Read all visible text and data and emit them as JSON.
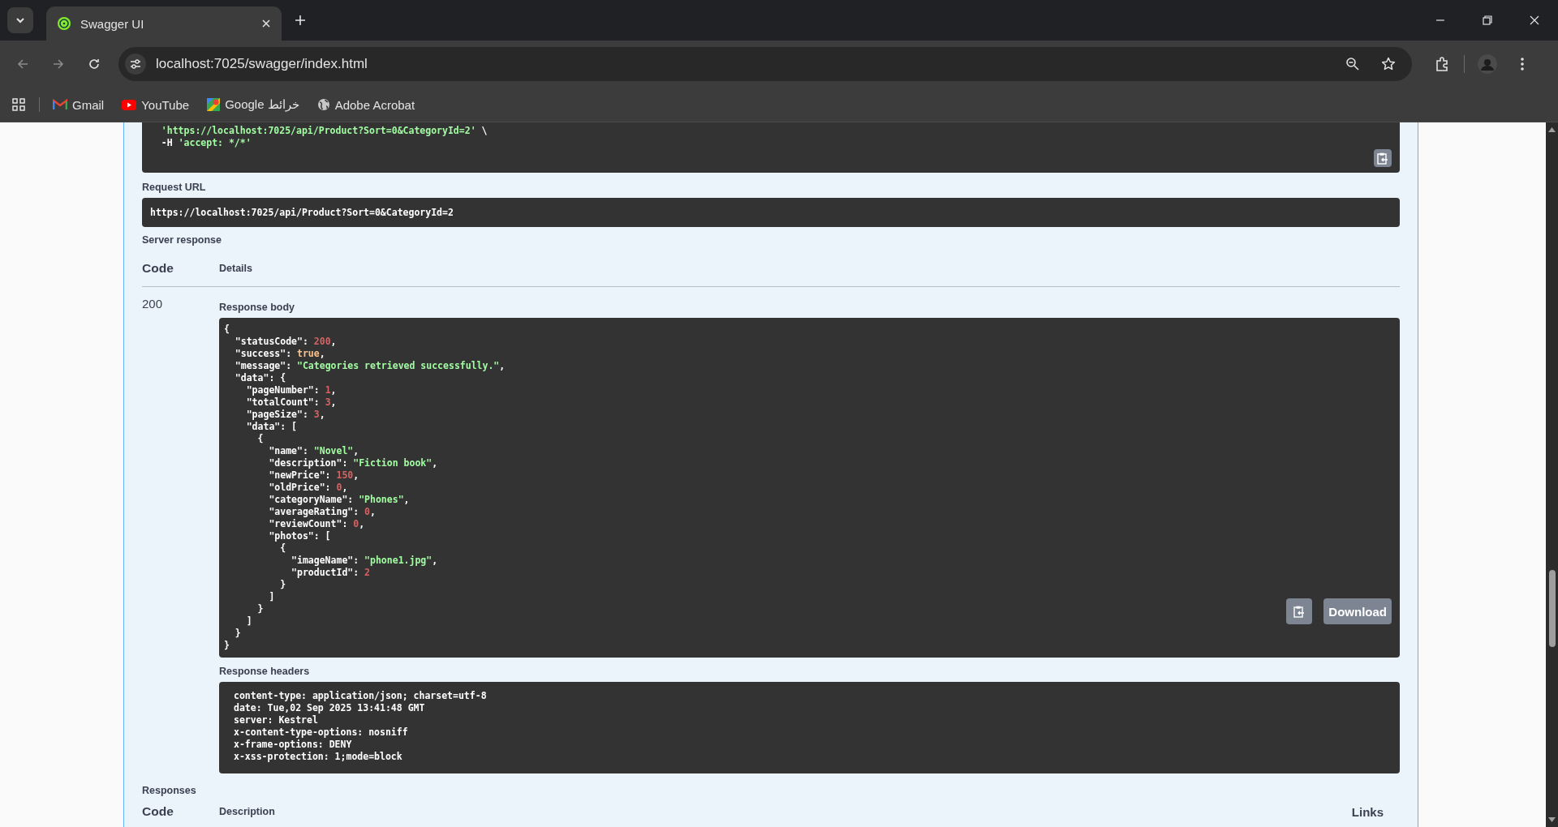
{
  "browser": {
    "tabs": [
      {
        "title": "Swagger UI",
        "selected": true
      }
    ],
    "address": "localhost:7025/swagger/index.html",
    "bookmarks": [
      {
        "label": "Gmail",
        "kind": "gmail"
      },
      {
        "label": "YouTube",
        "kind": "youtube"
      },
      {
        "label": "Google خرائط",
        "kind": "maps"
      },
      {
        "label": "Adobe Acrobat",
        "kind": "globe"
      }
    ]
  },
  "curl": {
    "lines": [
      [
        {
          "text": "  'https://localhost:7025/api/Product?Sort=0&CategoryId=2'",
          "kind": "string"
        },
        {
          "text": " \\",
          "kind": "plain"
        }
      ],
      [
        {
          "text": "  -H ",
          "kind": "plain"
        },
        {
          "text": "'accept: */*'",
          "kind": "string"
        }
      ]
    ]
  },
  "request_url": {
    "label": "Request URL",
    "value": "https://localhost:7025/api/Product?Sort=0&CategoryId=2"
  },
  "server_response": {
    "label": "Server response",
    "columns": [
      "Code",
      "Details"
    ],
    "code": "200",
    "body_label": "Response body",
    "body_lines": [
      [
        {
          "text": "{",
          "kind": "plain"
        }
      ],
      [
        {
          "text": "  \"statusCode\": ",
          "kind": "plain"
        },
        {
          "text": "200",
          "kind": "number"
        },
        {
          "text": ",",
          "kind": "plain"
        }
      ],
      [
        {
          "text": "  \"success\": ",
          "kind": "plain"
        },
        {
          "text": "true",
          "kind": "bool"
        },
        {
          "text": ",",
          "kind": "plain"
        }
      ],
      [
        {
          "text": "  \"message\": ",
          "kind": "plain"
        },
        {
          "text": "\"Categories retrieved successfully.\"",
          "kind": "string"
        },
        {
          "text": ",",
          "kind": "plain"
        }
      ],
      [
        {
          "text": "  \"data\": {",
          "kind": "plain"
        }
      ],
      [
        {
          "text": "    \"pageNumber\": ",
          "kind": "plain"
        },
        {
          "text": "1",
          "kind": "number"
        },
        {
          "text": ",",
          "kind": "plain"
        }
      ],
      [
        {
          "text": "    \"totalCount\": ",
          "kind": "plain"
        },
        {
          "text": "3",
          "kind": "number"
        },
        {
          "text": ",",
          "kind": "plain"
        }
      ],
      [
        {
          "text": "    \"pageSize\": ",
          "kind": "plain"
        },
        {
          "text": "3",
          "kind": "number"
        },
        {
          "text": ",",
          "kind": "plain"
        }
      ],
      [
        {
          "text": "    \"data\": [",
          "kind": "plain"
        }
      ],
      [
        {
          "text": "      {",
          "kind": "plain"
        }
      ],
      [
        {
          "text": "        \"name\": ",
          "kind": "plain"
        },
        {
          "text": "\"Novel\"",
          "kind": "string"
        },
        {
          "text": ",",
          "kind": "plain"
        }
      ],
      [
        {
          "text": "        \"description\": ",
          "kind": "plain"
        },
        {
          "text": "\"Fiction book\"",
          "kind": "string"
        },
        {
          "text": ",",
          "kind": "plain"
        }
      ],
      [
        {
          "text": "        \"newPrice\": ",
          "kind": "plain"
        },
        {
          "text": "150",
          "kind": "number"
        },
        {
          "text": ",",
          "kind": "plain"
        }
      ],
      [
        {
          "text": "        \"oldPrice\": ",
          "kind": "plain"
        },
        {
          "text": "0",
          "kind": "number"
        },
        {
          "text": ",",
          "kind": "plain"
        }
      ],
      [
        {
          "text": "        \"categoryName\": ",
          "kind": "plain"
        },
        {
          "text": "\"Phones\"",
          "kind": "string"
        },
        {
          "text": ",",
          "kind": "plain"
        }
      ],
      [
        {
          "text": "        \"averageRating\": ",
          "kind": "plain"
        },
        {
          "text": "0",
          "kind": "number"
        },
        {
          "text": ",",
          "kind": "plain"
        }
      ],
      [
        {
          "text": "        \"reviewCount\": ",
          "kind": "plain"
        },
        {
          "text": "0",
          "kind": "number"
        },
        {
          "text": ",",
          "kind": "plain"
        }
      ],
      [
        {
          "text": "        \"photos\": [",
          "kind": "plain"
        }
      ],
      [
        {
          "text": "          {",
          "kind": "plain"
        }
      ],
      [
        {
          "text": "            \"imageName\": ",
          "kind": "plain"
        },
        {
          "text": "\"phone1.jpg\"",
          "kind": "string"
        },
        {
          "text": ",",
          "kind": "plain"
        }
      ],
      [
        {
          "text": "            \"productId\": ",
          "kind": "plain"
        },
        {
          "text": "2",
          "kind": "number"
        }
      ],
      [
        {
          "text": "          }",
          "kind": "plain"
        }
      ],
      [
        {
          "text": "        ]",
          "kind": "plain"
        }
      ],
      [
        {
          "text": "      }",
          "kind": "plain"
        }
      ],
      [
        {
          "text": "    ]",
          "kind": "plain"
        }
      ],
      [
        {
          "text": "  }",
          "kind": "plain"
        }
      ],
      [
        {
          "text": "}",
          "kind": "plain"
        }
      ]
    ],
    "download": "Download",
    "headers_label": "Response headers",
    "headers": [
      "content-type: application/json; charset=utf-8",
      "date: Tue,02 Sep 2025 13:41:48 GMT",
      "server: Kestrel",
      "x-content-type-options: nosniff",
      "x-frame-options: DENY",
      "x-xss-protection: 1;mode=block"
    ]
  },
  "responses": {
    "label": "Responses",
    "columns": [
      "Code",
      "Description",
      "Links"
    ]
  }
}
